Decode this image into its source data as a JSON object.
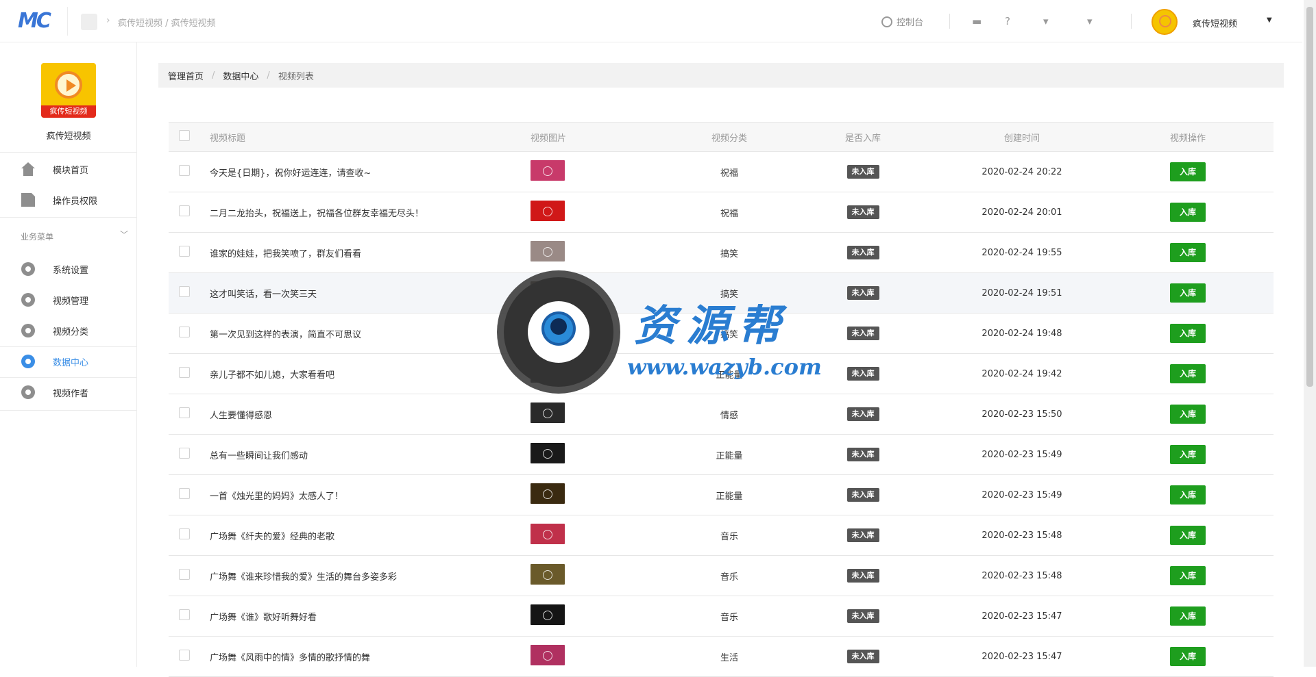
{
  "header": {
    "logo_text": "MC",
    "breadcrumb": "疯传短视频 / 疯传短视频",
    "console_label": "控制台",
    "user_name": "疯传短视频"
  },
  "sidebar": {
    "app_name": "疯传短视频",
    "logo_band": "疯传短视频",
    "top_items": [
      {
        "label": "模块首页",
        "icon": "home-icon"
      },
      {
        "label": "操作员权限",
        "icon": "document-icon"
      }
    ],
    "group_label": "业务菜单",
    "group_items": [
      {
        "label": "系统设置",
        "icon": "gear-icon",
        "active": false
      },
      {
        "label": "视频管理",
        "icon": "gear-icon",
        "active": false
      },
      {
        "label": "视频分类",
        "icon": "gear-icon",
        "active": false
      },
      {
        "label": "数据中心",
        "icon": "gear-icon",
        "active": true
      },
      {
        "label": "视频作者",
        "icon": "gear-icon",
        "active": false
      }
    ]
  },
  "breadcrumb": {
    "home": "管理首页",
    "section": "数据中心",
    "current": "视频列表"
  },
  "table": {
    "columns": [
      "视频标题",
      "视频图片",
      "视频分类",
      "是否入库",
      "创建时间",
      "视频操作"
    ],
    "rows": [
      {
        "title": "今天是{日期}，祝你好运连连，请查收~",
        "category": "祝福",
        "status": "未入库",
        "created": "2020-02-24 20:22",
        "action": "入库",
        "thumb": "#c83a6a"
      },
      {
        "title": "二月二龙抬头，祝福送上，祝福各位群友幸福无尽头！",
        "category": "祝福",
        "status": "未入库",
        "created": "2020-02-24 20:01",
        "action": "入库",
        "thumb": "#d01818"
      },
      {
        "title": "谁家的娃娃，把我笑喷了，群友们看看",
        "category": "搞笑",
        "status": "未入库",
        "created": "2020-02-24 19:55",
        "action": "入库",
        "thumb": "#9a8a86"
      },
      {
        "title": "这才叫笑话，看一次笑三天",
        "category": "搞笑",
        "status": "未入库",
        "created": "2020-02-24 19:51",
        "action": "入库",
        "thumb": "#7a6a5e"
      },
      {
        "title": "第一次见到这样的表演，简直不可思议",
        "category": "搞笑",
        "status": "未入库",
        "created": "2020-02-24 19:48",
        "action": "入库",
        "thumb": "#b02020"
      },
      {
        "title": "亲儿子都不如儿媳，大家看看吧",
        "category": "正能量",
        "status": "未入库",
        "created": "2020-02-24 19:42",
        "action": "入库",
        "thumb": "#4a4a4a"
      },
      {
        "title": "人生要懂得感恩",
        "category": "情感",
        "status": "未入库",
        "created": "2020-02-23 15:50",
        "action": "入库",
        "thumb": "#2a2a2a"
      },
      {
        "title": "总有一些瞬间让我们感动",
        "category": "正能量",
        "status": "未入库",
        "created": "2020-02-23 15:49",
        "action": "入库",
        "thumb": "#1a1a1a"
      },
      {
        "title": "一首《烛光里的妈妈》太感人了！",
        "category": "正能量",
        "status": "未入库",
        "created": "2020-02-23 15:49",
        "action": "入库",
        "thumb": "#3a2a10"
      },
      {
        "title": "广场舞《纤夫的爱》经典的老歌",
        "category": "音乐",
        "status": "未入库",
        "created": "2020-02-23 15:48",
        "action": "入库",
        "thumb": "#c0304a"
      },
      {
        "title": "广场舞《谁来珍惜我的爱》生活的舞台多姿多彩",
        "category": "音乐",
        "status": "未入库",
        "created": "2020-02-23 15:48",
        "action": "入库",
        "thumb": "#6a5a2a"
      },
      {
        "title": "广场舞《谁》歌好听舞好看",
        "category": "音乐",
        "status": "未入库",
        "created": "2020-02-23 15:47",
        "action": "入库",
        "thumb": "#151515"
      },
      {
        "title": "广场舞《风雨中的情》多情的歌抒情的舞",
        "category": "生活",
        "status": "未入库",
        "created": "2020-02-23 15:47",
        "action": "入库",
        "thumb": "#b03060"
      }
    ]
  },
  "watermark": {
    "title": "资源帮",
    "url": "www.wazyb.com"
  }
}
